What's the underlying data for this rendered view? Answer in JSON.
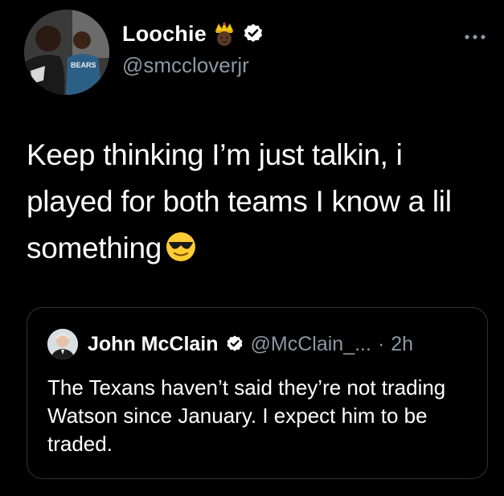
{
  "tweet": {
    "author": {
      "display_name": "Loochie",
      "handle": "@smccloverjr",
      "avatar_jersey_text": "BEARS"
    },
    "text": "Keep thinking I’m just talkin, i played for both teams I know a lil something",
    "emoji": "smiling-face-with-sunglasses"
  },
  "quote": {
    "display_name": "John McClain",
    "handle": "@McClain_...",
    "separator": "·",
    "time": "2h",
    "text": "The Texans haven’t said they’re not trading Watson since January. I expect him to be traded."
  },
  "colors": {
    "background": "#000000",
    "text_primary": "#ffffff",
    "text_secondary": "#8b98a5",
    "border": "#2f3336",
    "verified_badge": "#ffffff"
  }
}
